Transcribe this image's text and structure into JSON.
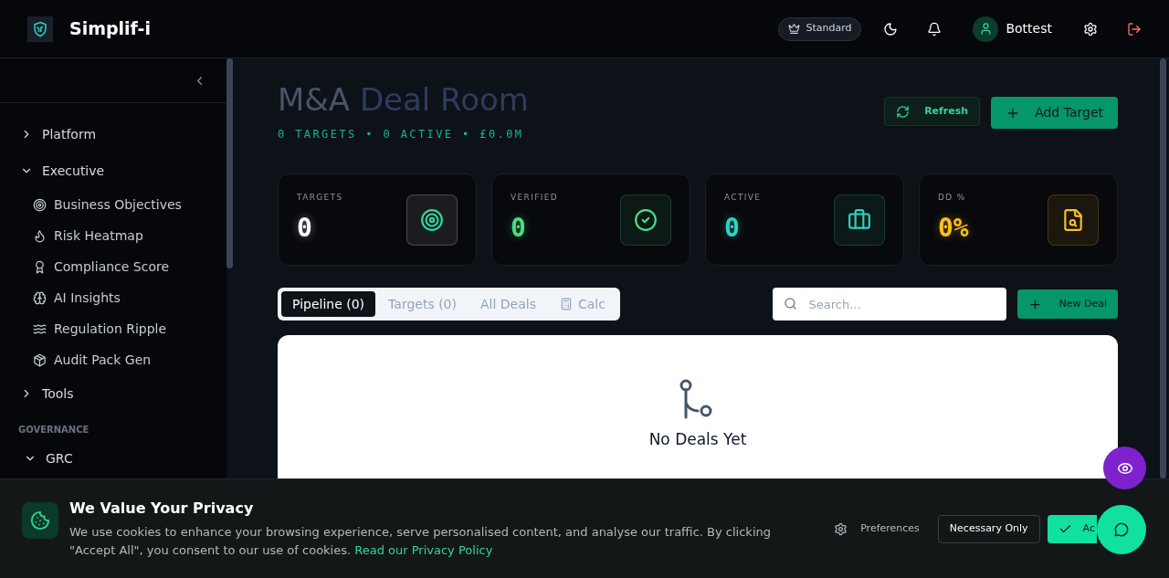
{
  "header": {
    "brand": "Simplif-i",
    "plan": "Standard",
    "user": "Bottest"
  },
  "sidebar": {
    "items": [
      {
        "label": "Platform",
        "expanded": false
      },
      {
        "label": "Executive",
        "expanded": true,
        "children": [
          {
            "label": "Business Objectives"
          },
          {
            "label": "Risk Heatmap"
          },
          {
            "label": "Compliance Score"
          },
          {
            "label": "AI Insights"
          },
          {
            "label": "Regulation Ripple"
          },
          {
            "label": "Audit Pack Gen"
          }
        ]
      },
      {
        "label": "Tools",
        "expanded": false
      }
    ],
    "section": "GOVERNANCE",
    "section_items": [
      {
        "label": "GRC",
        "expanded": true
      }
    ]
  },
  "page": {
    "title_lead": "M&A",
    "title_accent": "Deal Room",
    "subtitle": "0 TARGETS • 0 ACTIVE • £0.0M",
    "refresh": "Refresh",
    "add": "Add Target"
  },
  "stats": [
    {
      "label": "TARGETS",
      "value": "0",
      "color": "#ffffff"
    },
    {
      "label": "VERIFIED",
      "value": "0",
      "color": "#4ade80"
    },
    {
      "label": "ACTIVE",
      "value": "0",
      "color": "#2dd4bf"
    },
    {
      "label": "DD %",
      "value": "0%",
      "color": "#fbbf24"
    }
  ],
  "tabs": [
    {
      "label": "Pipeline (0)",
      "selected": true
    },
    {
      "label": "Targets (0)",
      "selected": false
    },
    {
      "label": "All Deals",
      "selected": false
    },
    {
      "label": "Calc",
      "selected": false
    }
  ],
  "search": {
    "placeholder": "Search..."
  },
  "new_deal": "New Deal",
  "empty": {
    "title": "No Deals Yet"
  },
  "cookie": {
    "title": "We Value Your Privacy",
    "text": "We use cookies to enhance your browsing experience, serve personalised content, and analyse our traffic. By clicking \"Accept All\", you consent to our use of cookies.",
    "link": "Read our Privacy Policy",
    "preferences": "Preferences",
    "necessary": "Necessary Only",
    "accept": "Ac"
  }
}
